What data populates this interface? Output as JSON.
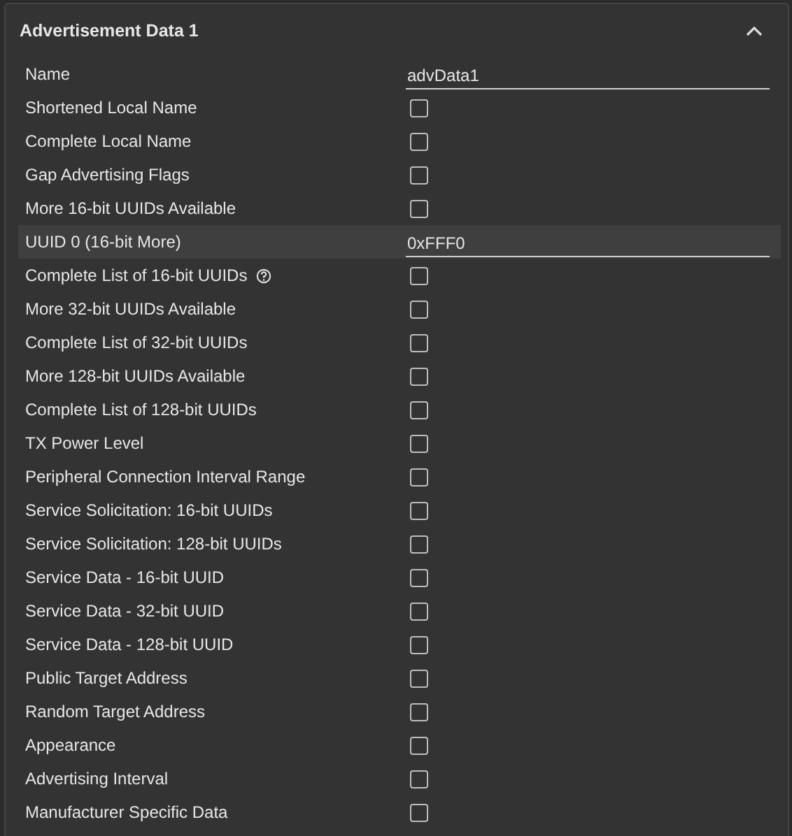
{
  "panel": {
    "title": "Advertisement Data 1",
    "expanded": true
  },
  "rows": [
    {
      "kind": "text",
      "label": "Name",
      "value": "advData1",
      "selected": false
    },
    {
      "kind": "checkbox",
      "label": "Shortened Local Name",
      "checked": false,
      "selected": false
    },
    {
      "kind": "checkbox",
      "label": "Complete Local Name",
      "checked": false,
      "selected": false
    },
    {
      "kind": "checkbox",
      "label": "Gap Advertising Flags",
      "checked": false,
      "selected": false
    },
    {
      "kind": "checkbox",
      "label": "More 16-bit UUIDs Available",
      "checked": false,
      "selected": false
    },
    {
      "kind": "text",
      "label": "UUID 0 (16-bit More)",
      "value": "0xFFF0",
      "selected": true
    },
    {
      "kind": "checkbox",
      "label": "Complete List of 16-bit UUIDs",
      "help": true,
      "checked": false,
      "selected": false
    },
    {
      "kind": "checkbox",
      "label": "More 32-bit UUIDs Available",
      "checked": false,
      "selected": false
    },
    {
      "kind": "checkbox",
      "label": "Complete List of 32-bit UUIDs",
      "checked": false,
      "selected": false
    },
    {
      "kind": "checkbox",
      "label": "More 128-bit UUIDs Available",
      "checked": false,
      "selected": false
    },
    {
      "kind": "checkbox",
      "label": "Complete List of 128-bit UUIDs",
      "checked": false,
      "selected": false
    },
    {
      "kind": "checkbox",
      "label": "TX Power Level",
      "checked": false,
      "selected": false
    },
    {
      "kind": "checkbox",
      "label": "Peripheral Connection Interval Range",
      "checked": false,
      "selected": false
    },
    {
      "kind": "checkbox",
      "label": "Service Solicitation: 16-bit UUIDs",
      "checked": false,
      "selected": false
    },
    {
      "kind": "checkbox",
      "label": "Service Solicitation: 128-bit UUIDs",
      "checked": false,
      "selected": false
    },
    {
      "kind": "checkbox",
      "label": "Service Data - 16-bit UUID",
      "checked": false,
      "selected": false
    },
    {
      "kind": "checkbox",
      "label": "Service Data - 32-bit UUID",
      "checked": false,
      "selected": false
    },
    {
      "kind": "checkbox",
      "label": "Service Data - 128-bit UUID",
      "checked": false,
      "selected": false
    },
    {
      "kind": "checkbox",
      "label": "Public Target Address",
      "checked": false,
      "selected": false
    },
    {
      "kind": "checkbox",
      "label": "Random Target Address",
      "checked": false,
      "selected": false
    },
    {
      "kind": "checkbox",
      "label": "Appearance",
      "checked": false,
      "selected": false
    },
    {
      "kind": "checkbox",
      "label": "Advertising Interval",
      "checked": false,
      "selected": false
    },
    {
      "kind": "checkbox",
      "label": "Manufacturer Specific Data",
      "checked": false,
      "selected": false
    }
  ]
}
